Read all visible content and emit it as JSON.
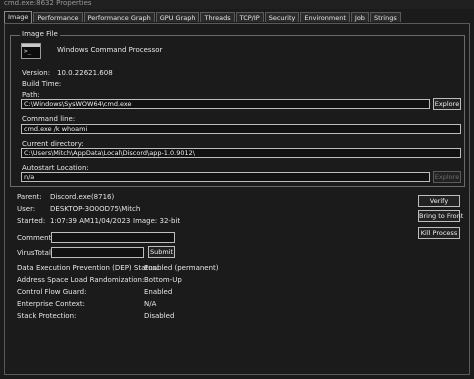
{
  "window": {
    "title": "cmd.exe:8632 Properties"
  },
  "tabs": [
    "Image",
    "Performance",
    "Performance Graph",
    "GPU Graph",
    "Threads",
    "TCP/IP",
    "Security",
    "Environment",
    "Job",
    "Strings"
  ],
  "image_file": {
    "group_title": "Image File",
    "description": "Windows Command Processor",
    "version_label": "Version:",
    "version_value": "10.0.22621.608",
    "build_time_label": "Build Time:",
    "path_label": "Path:",
    "path_value": "C:\\Windows\\SysWOW64\\cmd.exe",
    "explore_label": "Explore",
    "command_line_label": "Command line:",
    "command_line_value": "cmd.exe /k whoami",
    "current_directory_label": "Current directory:",
    "current_directory_value": "C:\\Users\\Mitch\\AppData\\Local\\Discord\\app-1.0.9012\\",
    "autostart_label": "Autostart Location:",
    "autostart_value": "n/a",
    "explore2_label": "Explore"
  },
  "process": {
    "parent_label": "Parent:",
    "parent_value": "Discord.exe(8716)",
    "user_label": "User:",
    "user_value": "DESKTOP-3O0OD75\\Mitch",
    "started_label": "Started:",
    "started_time": "1:07:39 AM",
    "started_date": "11/04/2023",
    "image_label": "Image: 32-bit",
    "comment_label": "Comment:",
    "virustotal_label": "VirusTotal:",
    "submit_label": "Submit",
    "verify_label": "Verify",
    "bring_to_front_label": "Bring to Front",
    "kill_process_label": "Kill Process"
  },
  "security": {
    "dep_label": "Data Execution Prevention (DEP) Status:",
    "dep_value": "Enabled (permanent)",
    "aslr_label": "Address Space Load Randomization:",
    "aslr_value": "Bottom-Up",
    "cfg_label": "Control Flow Guard:",
    "cfg_value": "Enabled",
    "enterprise_label": "Enterprise Context:",
    "enterprise_value": "N/A",
    "stack_label": "Stack Protection:",
    "stack_value": "Disabled"
  },
  "icons": {
    "app_icon": "command-prompt-icon"
  }
}
